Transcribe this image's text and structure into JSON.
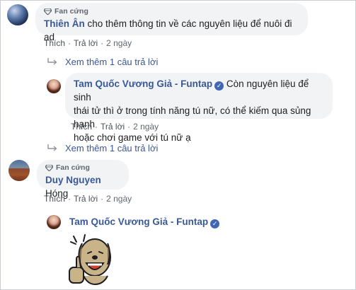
{
  "comments": [
    {
      "badge": "Fan cứng",
      "author": "Thiên Ân",
      "text": "cho thêm thông tin về các nguyên liệu để nuôi đi ad",
      "like_label": "Thích",
      "reply_label": "Trả lời",
      "time": "2 ngày",
      "more_replies": "Xem thêm 1 câu trả lời"
    },
    {
      "author": "Tam Quốc Vương Giả - Funtap",
      "text_lines": [
        "Còn nguyên liệu để sinh",
        "thái tử thì ở trong tính năng tú nữ, có thể kiếm qua sủng hạnh",
        "hoặc chơi game với tú nữ ạ"
      ],
      "like_label": "Thích",
      "reply_label": "Trả lời",
      "time": "2 ngày"
    },
    {
      "more_replies": "Xem thêm 1 câu trả lời"
    },
    {
      "badge": "Fan cứng",
      "author": "Duy Nguyen",
      "text": "Hóng",
      "like_label": "Thích",
      "reply_label": "Trả lời",
      "time": "2 ngày"
    },
    {
      "author": "Tam Quốc Vương Giả - Funtap"
    }
  ],
  "colors": {
    "author": "#385898",
    "bubble": "#f2f3f5",
    "verified": "#4267b2"
  },
  "icons": {
    "badge": "diamond-icon",
    "verified": "verified-check-icon",
    "reply_arrow": "reply-arrow-icon",
    "sticker": "thumbs-up-dog-sticker"
  }
}
